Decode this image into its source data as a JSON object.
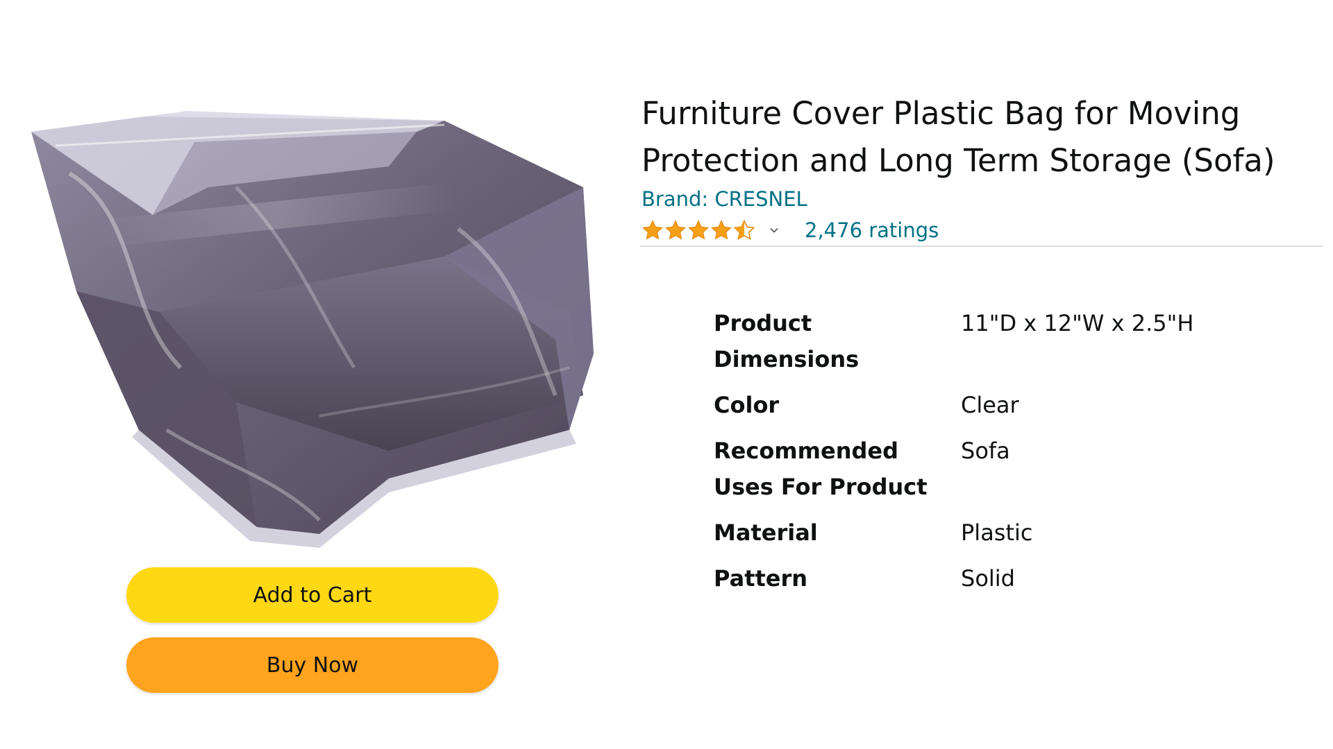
{
  "product": {
    "title": "Furniture Cover Plastic Bag for Moving Protection and Long Term Storage (Sofa)",
    "brand": "Brand: CRESNEL",
    "rating": 4.5,
    "ratings_count": "2,476 ratings",
    "image_icon": "covered-sofa-image"
  },
  "buttons": {
    "add_to_cart": "Add to Cart",
    "buy_now": "Buy Now"
  },
  "specs": [
    {
      "label": "Product Dimensions",
      "value": "11\"D x 12\"W x 2.5\"H"
    },
    {
      "label": "Color",
      "value": "Clear"
    },
    {
      "label": "Recommended Uses For Product",
      "value": "Sofa"
    },
    {
      "label": "Material",
      "value": "Plastic"
    },
    {
      "label": "Pattern",
      "value": "Solid"
    }
  ],
  "colors": {
    "link": "#007185",
    "star": "#f6a01a",
    "add_to_cart": "#ffd814",
    "buy_now": "#ffa41c",
    "text": "#0f1111"
  }
}
